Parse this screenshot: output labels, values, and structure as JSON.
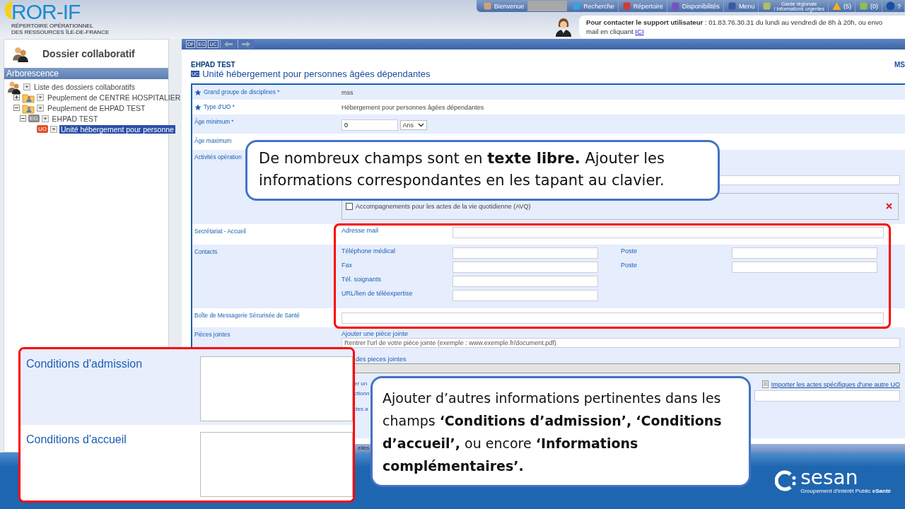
{
  "header": {
    "logo": "ROR-IF",
    "subtitle_lines": [
      "RÉPERTOIRE OPÉRATIONNEL",
      "DES RESSOURCES ÎLE-DE-FRANCE"
    ]
  },
  "nav": [
    {
      "label": "Bienvenue",
      "redacted": true
    },
    {
      "label": "Recherche"
    },
    {
      "label": "Répertoire"
    },
    {
      "label": "Disponibilités"
    },
    {
      "label": "Menu"
    },
    {
      "label": "Garde régionale",
      "sublabel": "/ Informations urgentes"
    },
    {
      "label": "(5)"
    },
    {
      "label": "(0)"
    },
    {
      "label": "?"
    }
  ],
  "support": {
    "text": "**Pour contacter le support utilisateur** : 01.83.76.30.31 du lundi au vendredi de 8h à 20h, ou envo",
    "line2": "mail en cliquant",
    "link": "ICI"
  },
  "sidebar": {
    "title": "Dossier collaboratif",
    "section": "Arborescence",
    "tree": {
      "label": "Liste des dossiers collaboratifs",
      "selected": false,
      "children": [
        {
          "label": "Peuplement de CENTRE HOSPITALIER",
          "selected": false,
          "expanded": false
        },
        {
          "label": "Peuplement de EHPAD TEST",
          "selected": false,
          "expanded": true,
          "children": [
            {
              "label": "EHPAD TEST",
              "badge": "EG",
              "color": "#8c8c8c",
              "selected": false,
              "expanded": true,
              "children": [
                {
                  "label": "Unité hébergement pour personne",
                  "badge": "UO",
                  "color": "#e0502a",
                  "selected": true
                }
              ]
            }
          ]
        }
      ]
    }
  },
  "toolbar": {
    "buttons": [
      "DF",
      "EG",
      "UC"
    ]
  },
  "form": {
    "organisation": "EHPAD TEST",
    "badge": "UC",
    "title": "Unité hébergement pour personnes âgées dépendantes",
    "corner": "MS",
    "rows": [
      {
        "kind": "static",
        "label": "Grand groupe de disciplines *",
        "value": "mss"
      },
      {
        "kind": "static",
        "label": "Type d'UO *",
        "value": "Hébergement pour personnes âgées dépendantes"
      },
      {
        "kind": "age",
        "label": "Âge minimum *",
        "value": "0",
        "unit": "Ans"
      },
      {
        "kind": "plain",
        "label": "Âge maximum"
      },
      {
        "kind": "activities",
        "label": "Activités opération",
        "option": {
          "label": "Accompagnements pour les actes de la vie quotidienne (AVQ)",
          "checked": false
        }
      },
      {
        "kind": "email",
        "label": "Secrétariat - Accueil",
        "field": "Adresse mail"
      },
      {
        "kind": "contacts",
        "label": "Contacts",
        "lines": [
          [
            {
              "label": "Téléphone médical"
            },
            {
              "label": "Poste"
            }
          ],
          [
            {
              "label": "Fax"
            },
            {
              "label": "Poste"
            }
          ],
          [
            {
              "label": "Tél. soignants"
            }
          ],
          [
            {
              "label": "URL/lien de téléexpertise"
            }
          ]
        ]
      },
      {
        "kind": "mailbox",
        "label": "Boîte de Messagerie Sécurisée de Santé"
      },
      {
        "kind": "attachments",
        "label": "Pièces jointes",
        "add_label": "Ajouter une pièce jointe",
        "placeholder": "Rentrer l'url de votre pièce jointe (exemple : www.exemple.fr/document.pdf)",
        "list_label": "des pieces jointes",
        "import_link": "Importer les actes spécifiques d'une autre UO",
        "fragments": [
          "er un",
          "ctionn",
          "des a"
        ]
      }
    ],
    "bottom_tab": "elles"
  },
  "slide": {
    "callouts": [
      {
        "text": "De nombreux champs sont en **texte libre.** Ajouter les informations correspondantes en les tapant au clavier."
      },
      {
        "text": "Ajouter d’autres informations pertinentes dans les champs **‘Conditions d’admission’,** **‘Conditions d’accueil’,** ou encore **‘Informations complémentaires’.**"
      }
    ],
    "conditions": [
      {
        "label": "Conditions d'admission"
      },
      {
        "label": "Conditions d'accueil"
      }
    ],
    "footer": {
      "logo": "sesan",
      "tagline": "Groupement d'Intérêt Public **eSanté**"
    }
  }
}
